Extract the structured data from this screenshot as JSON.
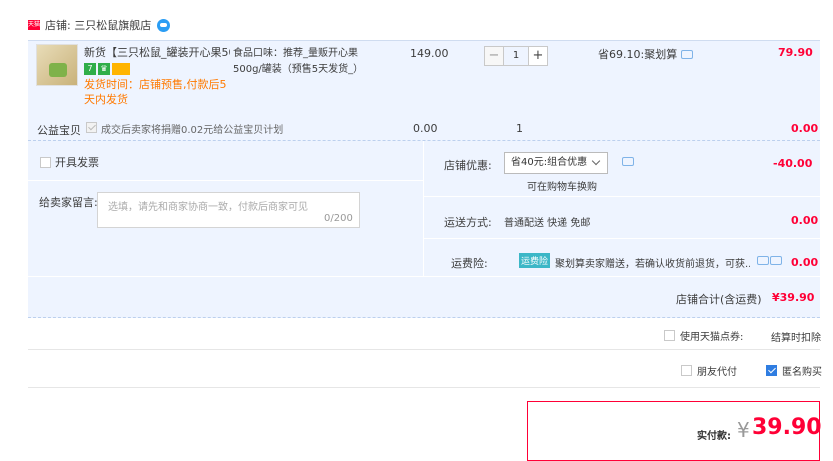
{
  "shop": {
    "badge": "天猫",
    "label": "店铺: 三只松鼠旗舰店"
  },
  "item": {
    "title": "新货【三只松鼠_罐装开心果50...",
    "tags": [
      "7",
      "♛",
      ""
    ],
    "shipping_note": "发货时间：店铺预售,付款后5天内发货",
    "sku": "食品口味：推荐_量贩开心果500g/罐装（预售5天发货_）",
    "price": "149.00",
    "quantity": "1",
    "promo": "省69.10:聚划算",
    "subtotal": "79.90"
  },
  "charity": {
    "label": "公益宝贝",
    "text": "成交后卖家将捐赠0.02元给公益宝贝计划",
    "price": "0.00",
    "quantity": "1",
    "subtotal": "0.00"
  },
  "options": {
    "invoice_label": "开具发票",
    "message_label": "给卖家留言:",
    "message_placeholder": "选填，请先和商家协商一致，付款后商家可见",
    "message_count": "0/200",
    "coupon_label": "店铺优惠:",
    "coupon_selected": "省40元:组合优惠",
    "coupon_link": "可在购物车换购",
    "coupon_amount": "-40.00",
    "shipping_label": "运送方式:",
    "shipping_value": "普通配送 快递 免邮",
    "shipping_amount": "0.00",
    "insurance_label": "运费险:",
    "insurance_badge": "运费险",
    "insurance_text": "聚划算卖家赠送，若确认收货前退货，可获...",
    "insurance_amount": "0.00",
    "shop_total_label": "店铺合计(含运费)",
    "shop_total": "¥39.90"
  },
  "footer": {
    "tmall_points_label": "使用天猫点券:",
    "tmall_points_note": "结算时扣除",
    "friend_pay_label": "朋友代付",
    "anonymous_label": "匿名购买",
    "pay_label": "实付款:",
    "pay_currency": "¥",
    "pay_amount": "39.90"
  },
  "colors": {
    "accent": "#ff0036",
    "panel": "#eef4ff",
    "orange": "#ff7a00"
  }
}
